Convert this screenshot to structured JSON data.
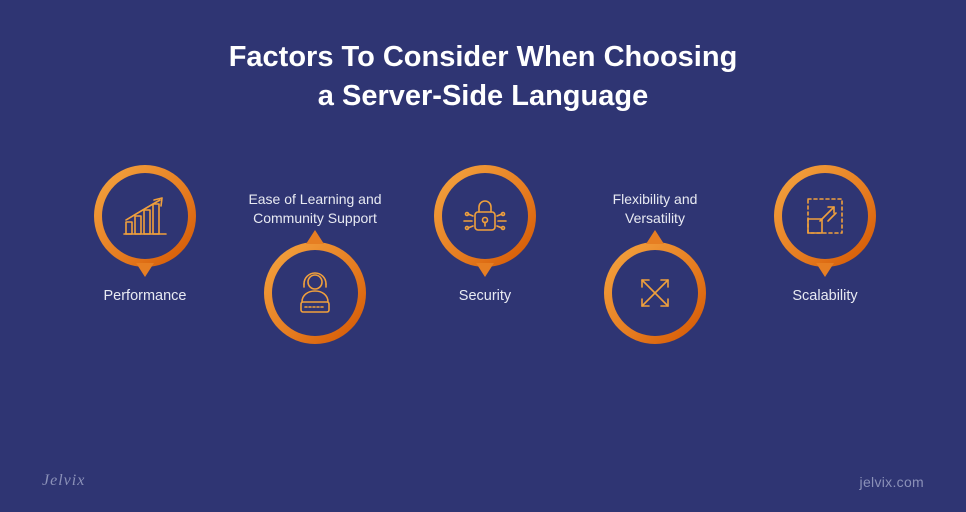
{
  "title_line1": "Factors To Consider When Choosing",
  "title_line2": "a Server-Side Language",
  "factors": {
    "0": {
      "label": "Performance",
      "icon": "growth-chart-icon"
    },
    "1": {
      "label": "Ease of Learning and\nCommunity Support",
      "icon": "support-person-icon"
    },
    "2": {
      "label": "Security",
      "icon": "lock-icon"
    },
    "3": {
      "label": "Flexibility and\nVersatility",
      "icon": "expand-arrows-icon"
    },
    "4": {
      "label": "Scalability",
      "icon": "scale-icon"
    }
  },
  "brand": "Jelvix",
  "site": "jelvix.com",
  "colors": {
    "background": "#2f3573",
    "accent_gradient_top": "#f5a742",
    "accent_gradient_bottom": "#d35400",
    "icon_stroke": "#f0a03c",
    "text": "#ffffff",
    "footer_text": "#8b91b8"
  }
}
